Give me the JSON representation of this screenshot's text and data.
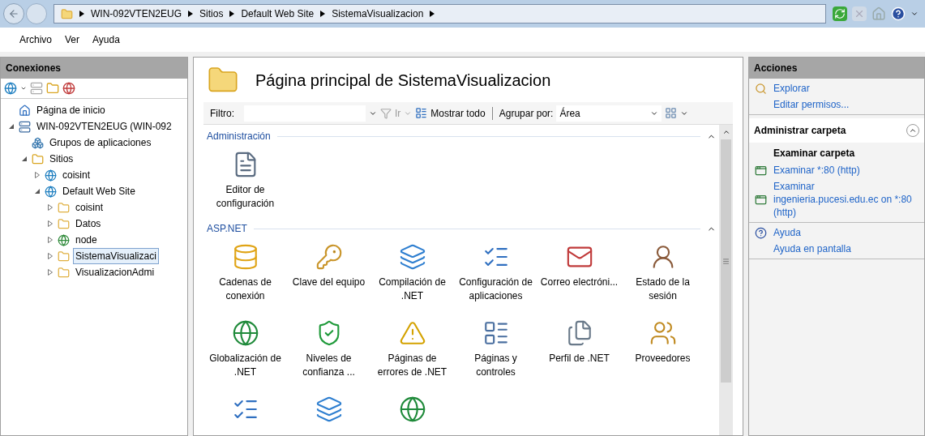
{
  "breadcrumb": [
    "WIN-092VTEN2EUG",
    "Sitios",
    "Default Web Site",
    "SistemaVisualizacion"
  ],
  "menu": [
    "Archivo",
    "Ver",
    "Ayuda"
  ],
  "connections": {
    "title": "Conexiones",
    "tree": [
      {
        "label": "Página de inicio",
        "kind": "home",
        "selected": false
      },
      {
        "label": "WIN-092VTEN2EUG (WIN-092",
        "kind": "server",
        "expanded": true,
        "selected": false,
        "children": [
          {
            "label": "Grupos de aplicaciones",
            "kind": "pool",
            "selected": false
          },
          {
            "label": "Sitios",
            "kind": "sites",
            "expanded": true,
            "selected": false,
            "children": [
              {
                "label": "coisint",
                "kind": "site",
                "expanded": false,
                "selected": false
              },
              {
                "label": "Default Web Site",
                "kind": "site",
                "expanded": true,
                "selected": false,
                "children": [
                  {
                    "label": "coisint",
                    "kind": "folder",
                    "expanded": false,
                    "selected": false
                  },
                  {
                    "label": "Datos",
                    "kind": "folder",
                    "expanded": false,
                    "selected": false
                  },
                  {
                    "label": "node",
                    "kind": "app",
                    "expanded": false,
                    "selected": false
                  },
                  {
                    "label": "SistemaVisualizaci",
                    "kind": "folder",
                    "expanded": false,
                    "selected": true
                  },
                  {
                    "label": "VisualizacionAdmi",
                    "kind": "folder",
                    "expanded": false,
                    "selected": false
                  }
                ]
              }
            ]
          }
        ]
      }
    ]
  },
  "page": {
    "title": "Página principal de SistemaVisualizacion",
    "filter": {
      "label": "Filtro:",
      "go": "Ir",
      "show_all": "Mostrar todo",
      "group_label": "Agrupar por:",
      "group_value": "Área"
    },
    "groups": [
      {
        "title": "Administración",
        "expanded": true,
        "features": [
          {
            "label": "Editor de configuración",
            "kind": "editor"
          }
        ]
      },
      {
        "title": "ASP.NET",
        "expanded": true,
        "features": [
          {
            "label": "Cadenas de conexión",
            "kind": "db"
          },
          {
            "label": "Clave del equipo",
            "kind": "key"
          },
          {
            "label": "Compilación de .NET",
            "kind": "compile"
          },
          {
            "label": "Configuración de aplicaciones",
            "kind": "list"
          },
          {
            "label": "Correo electróni...",
            "kind": "mail"
          },
          {
            "label": "Estado de la sesión",
            "kind": "user"
          },
          {
            "label": "Globalización de .NET",
            "kind": "globe"
          },
          {
            "label": "Niveles de confianza ...",
            "kind": "trust"
          },
          {
            "label": "Páginas de errores de .NET",
            "kind": "error"
          },
          {
            "label": "Páginas y controles",
            "kind": "pages"
          },
          {
            "label": "Perfil de .NET",
            "kind": "profile"
          },
          {
            "label": "Proveedores",
            "kind": "providers"
          },
          {
            "kind": "list"
          },
          {
            "kind": "compile"
          },
          {
            "kind": "globe"
          }
        ]
      }
    ]
  },
  "actions": {
    "title": "Acciones",
    "sections": [
      {
        "items": [
          {
            "label": "Explorar",
            "kind": "explore"
          },
          {
            "label": "Editar permisos...",
            "kind": "link"
          }
        ]
      },
      {
        "title": "Administrar carpeta",
        "expanded": true,
        "items": [
          {
            "label": "Examinar carpeta",
            "kind": "heading"
          },
          {
            "label": "Examinar *:80 (http)",
            "kind": "browse"
          },
          {
            "label": "Examinar ingenieria.pucesi.edu.ec on *:80 (http)",
            "kind": "browse"
          }
        ]
      },
      {
        "items": [
          {
            "label": "Ayuda",
            "kind": "help"
          },
          {
            "label": "Ayuda en pantalla",
            "kind": "link"
          }
        ]
      }
    ]
  }
}
